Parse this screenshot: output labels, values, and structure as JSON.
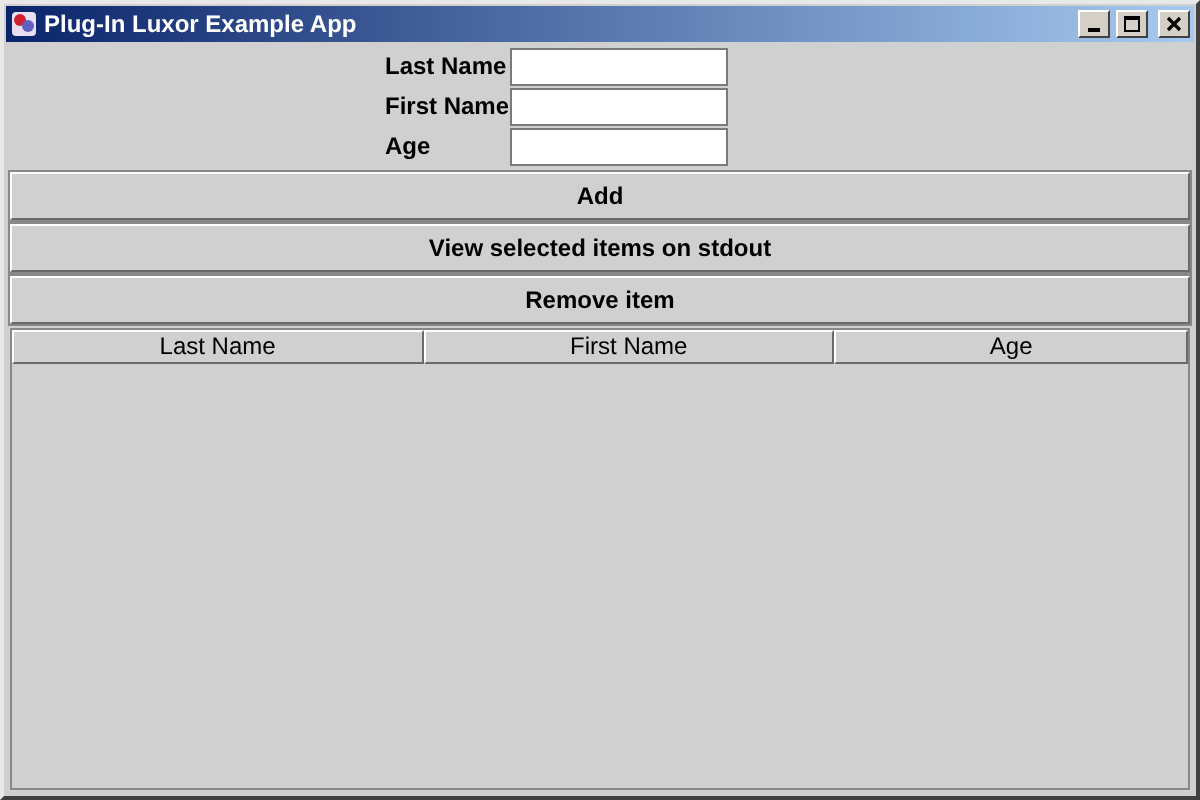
{
  "window": {
    "title": "Plug-In Luxor Example App"
  },
  "form": [
    {
      "label": "Last Name"
    },
    {
      "label": "First Name"
    },
    {
      "label": "Age"
    }
  ],
  "buttons": [
    "Add",
    "View selected items on stdout",
    "Remove item"
  ],
  "table": {
    "columns": [
      "Last Name",
      "First Name",
      "Age"
    ]
  }
}
